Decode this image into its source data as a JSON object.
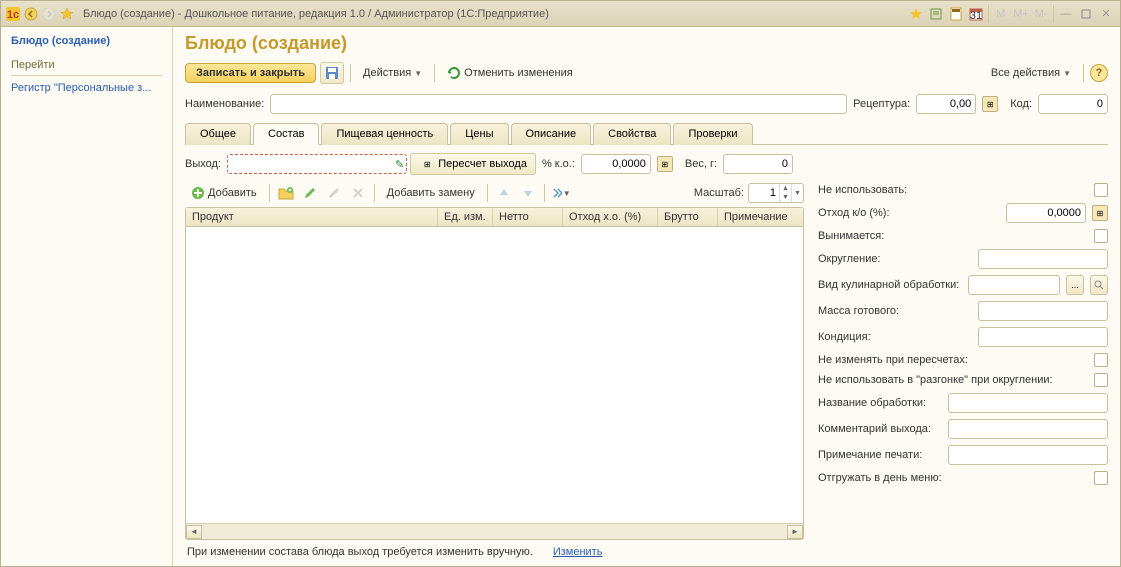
{
  "window": {
    "title": "Блюдо (создание) - Дошкольное питание, редакция 1.0 / Администратор  (1С:Предприятие)",
    "mem_m": "M",
    "mem_mplus": "M+",
    "mem_mminus": "M-"
  },
  "sidebar": {
    "title": "Блюдо (создание)",
    "section": "Перейти",
    "link": "Регистр \"Персональные з..."
  },
  "page": {
    "title": "Блюдо (создание)"
  },
  "toolbar": {
    "save_close": "Записать и закрыть",
    "actions": "Действия",
    "cancel": "Отменить изменения",
    "all_actions": "Все действия"
  },
  "fields": {
    "name_label": "Наименование:",
    "name_value": "",
    "recipe_label": "Рецептура:",
    "recipe_value": "0,00",
    "code_label": "Код:",
    "code_value": "0"
  },
  "tabs": {
    "t1": "Общее",
    "t2": "Состав",
    "t3": "Пищевая ценность",
    "t4": "Цены",
    "t5": "Описание",
    "t6": "Свойства",
    "t7": "Проверки"
  },
  "row2": {
    "out_label": "Выход:",
    "out_value": "",
    "recalc": "Пересчет выхода",
    "ko_label": "% к.о.:",
    "ko_value": "0,0000",
    "weight_label": "Вес, г:",
    "weight_value": "0"
  },
  "list_toolbar": {
    "add": "Добавить",
    "add_replace": "Добавить замену",
    "scale_label": "Масштаб:",
    "scale_value": "1"
  },
  "table": {
    "c1": "Продукт",
    "c2": "Ед. изм.",
    "c3": "Нетто",
    "c4": "Отход х.о. (%)",
    "c5": "Брутто",
    "c6": "Примечание"
  },
  "footer": {
    "note": "При изменении состава блюда выход требуется изменить вручную.",
    "link": "Изменить"
  },
  "props": {
    "no_use": "Не использовать:",
    "otkhod": "Отход к/о (%):",
    "otkhod_val": "0,0000",
    "vynim": "Вынимается:",
    "okrug": "Округление:",
    "vid_obr": "Вид кулинарной обработки:",
    "massa": "Масса готового:",
    "kond": "Кондиция:",
    "neizm": "Не изменять при пересчетах:",
    "neisp_razg": "Не использовать в \"разгонке\" при округлении:",
    "nazv_obr": "Название обработки:",
    "komm_vyh": "Комментарий выхода:",
    "prim_pech": "Примечание печати:",
    "otgr": "Отгружать в день меню:"
  }
}
